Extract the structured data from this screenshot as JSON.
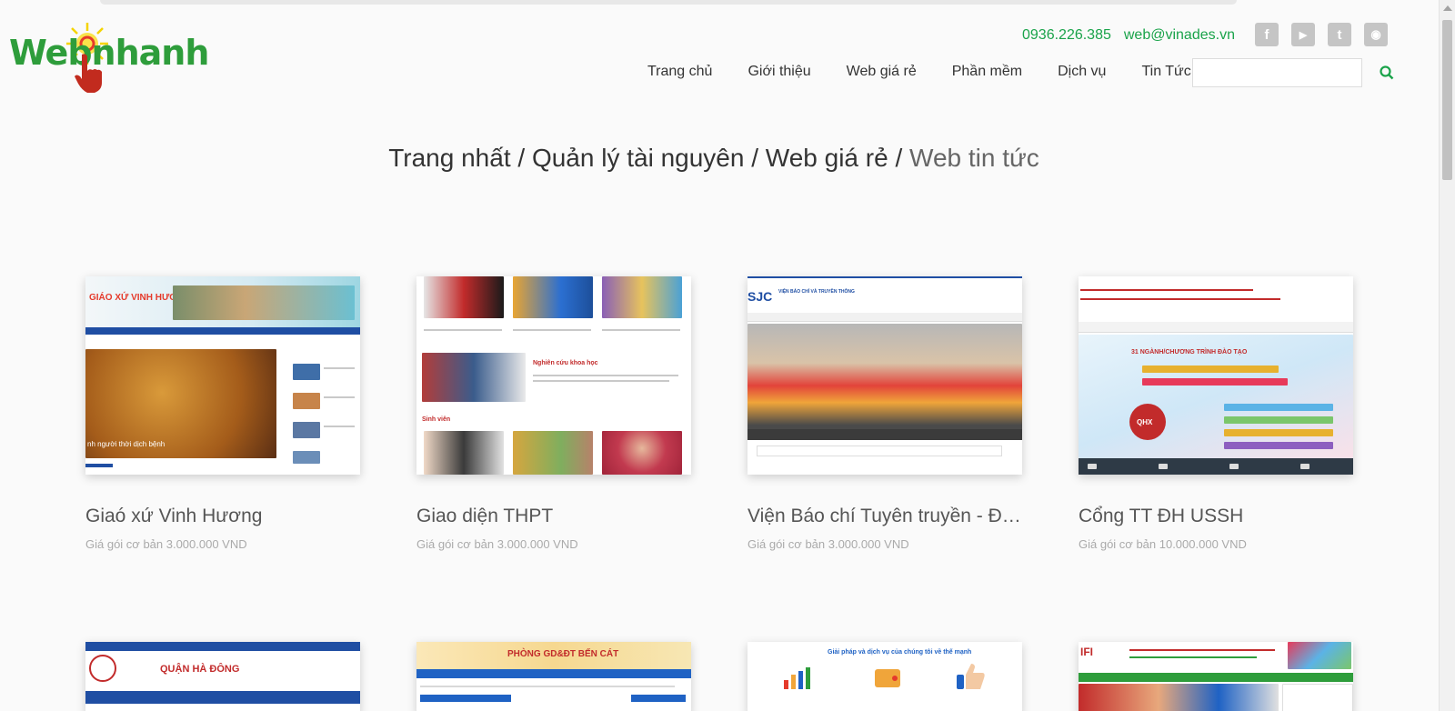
{
  "header": {
    "logo_text": "Webnhanh",
    "phone": "0936.226.385",
    "email": "web@vinades.vn",
    "social": [
      {
        "icon": "facebook-icon",
        "glyph": "f"
      },
      {
        "icon": "youtube-icon",
        "glyph": "▶"
      },
      {
        "icon": "twitter-icon",
        "glyph": "t"
      },
      {
        "icon": "rss-icon",
        "glyph": "◉"
      }
    ],
    "nav": [
      "Trang chủ",
      "Giới thiệu",
      "Web giá rẻ",
      "Phần mềm",
      "Dịch vụ",
      "Tin Tức"
    ],
    "search_placeholder": ""
  },
  "breadcrumb": {
    "items": [
      "Trang nhất",
      "Quản lý tài nguyên",
      "Web giá rẻ"
    ],
    "current": "Web tin tức"
  },
  "products": [
    {
      "title": "Giaó xứ Vinh Hương",
      "price": "Giá gói cơ bản 3.000.000 VND",
      "thumb_banner": "GIÁO XỨ VINH HƯƠNG",
      "thumb_caption": "nh người thời dịch bệnh"
    },
    {
      "title": "Giao diện THPT",
      "price": "Giá gói cơ bản 3.000.000 VND",
      "thumb_banner": "Nghiên cứu khoa học",
      "thumb_caption": "Sinh viên"
    },
    {
      "title": "Viện Báo chí Tuyên truyền - ĐH …",
      "price": "Giá gói cơ bản 3.000.000 VND",
      "thumb_banner": "SJC",
      "thumb_caption": "VIỆN BÁO CHÍ VÀ TRUYỀN THÔNG"
    },
    {
      "title": "Cổng TT ĐH USSH",
      "price": "Giá gói cơ bản 10.000.000 VND",
      "thumb_banner": "31 NGÀNH/CHƯƠNG TRÌNH ĐÀO TẠO",
      "thumb_caption": "QHX"
    }
  ],
  "products_row2": [
    {
      "thumb_banner": "QUẬN HÀ ĐÔNG"
    },
    {
      "thumb_banner": "PHÒNG GD&ĐT BẾN CÁT"
    },
    {
      "thumb_banner": "Giải pháp và dịch vụ của chúng tôi về thế mạnh"
    },
    {
      "thumb_banner": "IFI"
    }
  ],
  "colors": {
    "accent": "#1aa34a",
    "nav_text": "#333333",
    "price": "#aaaaaa"
  }
}
